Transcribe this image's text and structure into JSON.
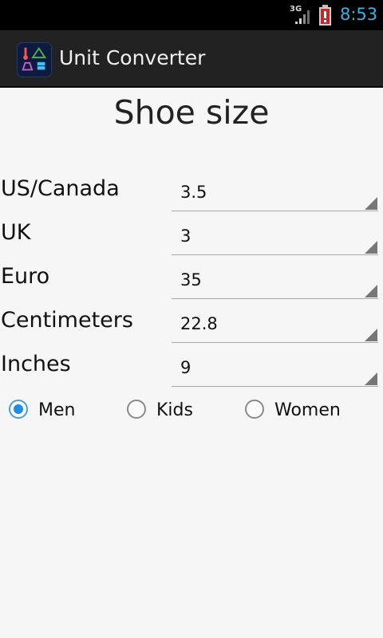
{
  "status_bar": {
    "network": "3G",
    "time": "8:53",
    "signal_icon": "signal-bars-icon",
    "battery_icon": "battery-alert-icon",
    "time_color": "#33b5e5"
  },
  "app_bar": {
    "title": "Unit Converter",
    "icon": "unit-converter-app-icon"
  },
  "page": {
    "title": "Shoe size"
  },
  "conversions": [
    {
      "label": "US/Canada",
      "value": "3.5"
    },
    {
      "label": "UK",
      "value": "3"
    },
    {
      "label": "Euro",
      "value": "35"
    },
    {
      "label": "Centimeters",
      "value": "22.8"
    },
    {
      "label": "Inches",
      "value": "9"
    }
  ],
  "gender": {
    "selected": "Men",
    "options": [
      {
        "label": "Men"
      },
      {
        "label": "Kids"
      },
      {
        "label": "Women"
      }
    ]
  },
  "colors": {
    "accent": "#33b5e5",
    "radio_selected": "#1d8fe0"
  }
}
